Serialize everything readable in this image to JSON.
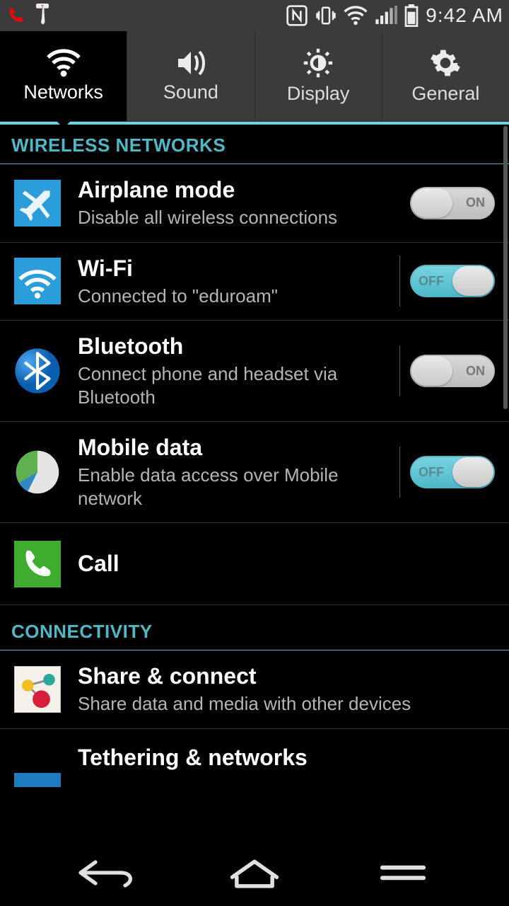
{
  "status": {
    "time": "9:42 AM"
  },
  "tabs": [
    {
      "label": "Networks",
      "active": true,
      "icon": "wifi"
    },
    {
      "label": "Sound",
      "active": false,
      "icon": "sound"
    },
    {
      "label": "Display",
      "active": false,
      "icon": "brightness"
    },
    {
      "label": "General",
      "active": false,
      "icon": "gear"
    }
  ],
  "sections": [
    {
      "header": "WIRELESS NETWORKS",
      "items": [
        {
          "key": "airplane",
          "title": "Airplane mode",
          "sub": "Disable all wireless connections",
          "toggle": "off",
          "divider": false
        },
        {
          "key": "wifi",
          "title": "Wi-Fi",
          "sub": "Connected to \"eduroam\"",
          "toggle": "on",
          "divider": true
        },
        {
          "key": "bluetooth",
          "title": "Bluetooth",
          "sub": "Connect phone and headset via Bluetooth",
          "toggle": "off",
          "divider": true
        },
        {
          "key": "mobiledata",
          "title": "Mobile data",
          "sub": "Enable data access over Mobile network",
          "toggle": "on",
          "divider": true
        },
        {
          "key": "call",
          "title": "Call",
          "sub": null,
          "toggle": null,
          "divider": false
        }
      ]
    },
    {
      "header": "CONNECTIVITY",
      "items": [
        {
          "key": "share",
          "title": "Share & connect",
          "sub": "Share data and media with other devices",
          "toggle": null,
          "divider": false
        },
        {
          "key": "tethering",
          "title": "Tethering & networks",
          "sub": null,
          "toggle": null,
          "divider": false
        }
      ]
    }
  ],
  "toggle_labels": {
    "off": "OFF",
    "on": "ON"
  }
}
